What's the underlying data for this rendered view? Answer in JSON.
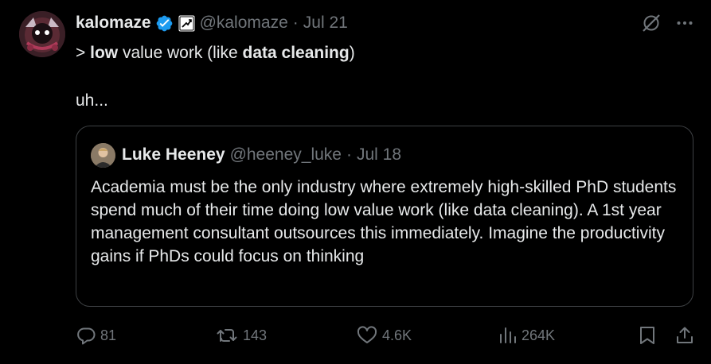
{
  "tweet": {
    "author_name": "kalomaze",
    "author_handle": "@kalomaze",
    "separator": "·",
    "date": "Jul 21",
    "text": {
      "prefix": "> ",
      "bold1": "low",
      "middle": " value work (like ",
      "bold2": "data cleaning",
      "suffix": ")",
      "line2": "uh..."
    },
    "icons": {
      "verified": "verified-badge-icon",
      "affiliation": "affiliation-badge-icon",
      "grok": "grok-icon",
      "more": "more-options-icon"
    }
  },
  "quote": {
    "author_name": "Luke Heeney",
    "author_handle": "@heeney_luke",
    "separator": "·",
    "date": "Jul 18",
    "text": "Academia must be the only industry where extremely high-skilled PhD students spend much of their time doing low value work (like data cleaning). A 1st year management consultant outsources this immediately. Imagine the productivity gains if PhDs could focus on thinking"
  },
  "actions": {
    "replies": "81",
    "retweets": "143",
    "likes": "4.6K",
    "views": "264K"
  },
  "colors": {
    "background": "#000000",
    "text": "#e7e9ea",
    "muted": "#71767b",
    "border": "#3e4144",
    "verified": "#1d9bf0"
  }
}
